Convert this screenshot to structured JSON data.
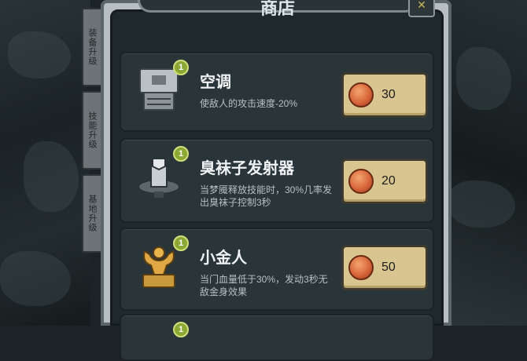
{
  "title": "商店",
  "close_label": "✕",
  "side_tabs": [
    "装备升级",
    "技能升级",
    "基地升级"
  ],
  "items": [
    {
      "name": "空调",
      "level": "1",
      "desc": "使敌人的攻击速度-20%",
      "price": "30",
      "icon": "air-conditioner-icon"
    },
    {
      "name": "臭袜子发射器",
      "level": "1",
      "desc": "当梦魇释放技能时，30%几率发出臭袜子控制3秒",
      "price": "20",
      "icon": "sock-launcher-icon"
    },
    {
      "name": "小金人",
      "level": "1",
      "desc": "当门血量低于30%，发动3秒无敌金身效果",
      "price": "50",
      "icon": "golden-man-icon"
    },
    {
      "level": "1"
    }
  ],
  "colors": {
    "badge": "#8aa833",
    "button": "#d9c58f",
    "panel": "#1f292d"
  }
}
